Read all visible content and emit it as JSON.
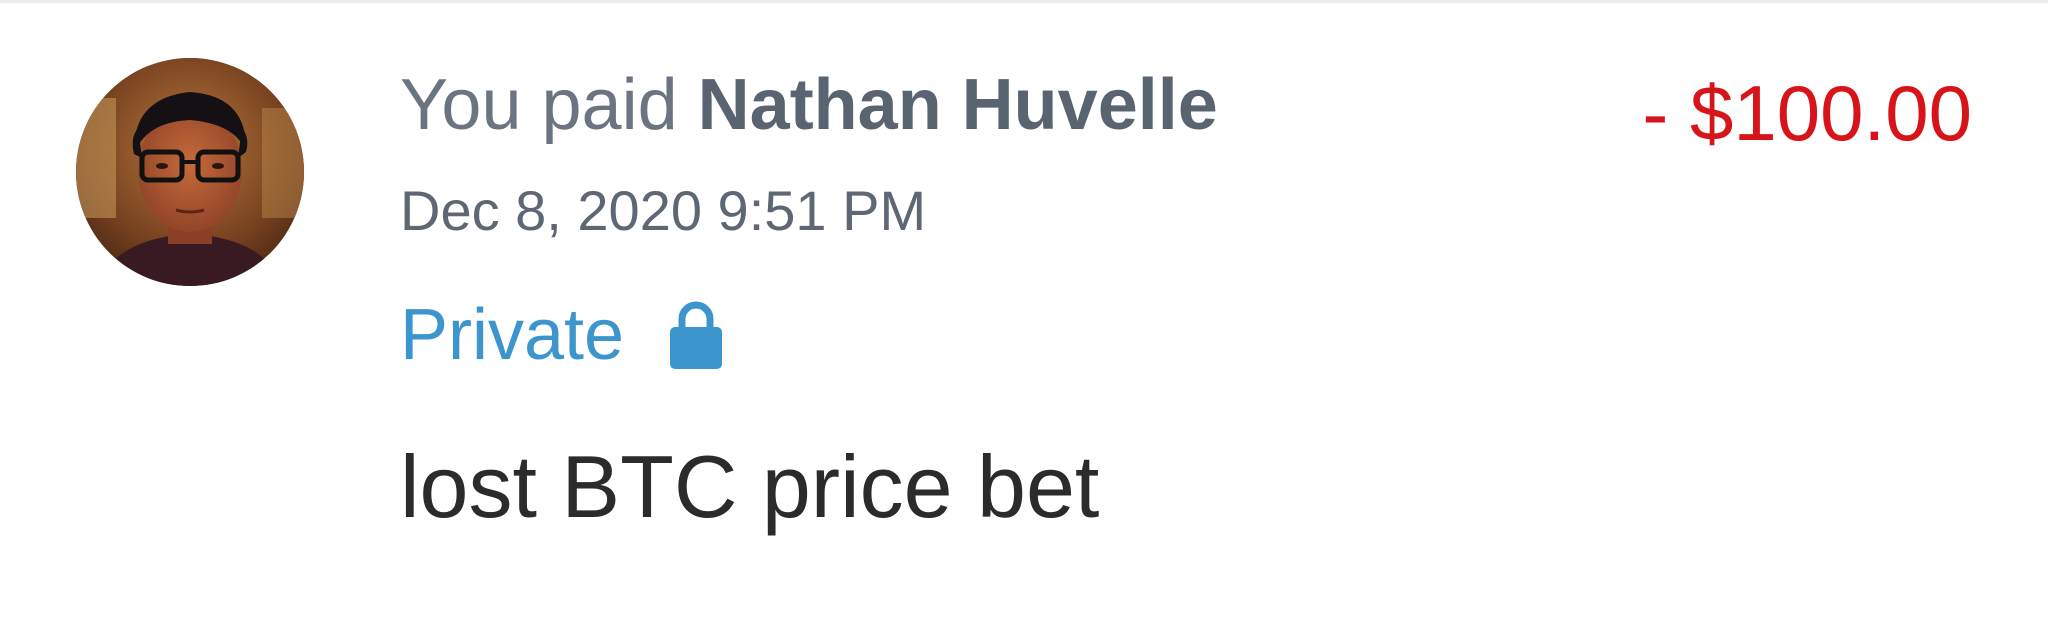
{
  "transaction": {
    "headline_prefix": "You paid",
    "recipient_name": "Nathan Huvelle",
    "amount": "- $100.00",
    "timestamp": "Dec 8, 2020 9:51 PM",
    "privacy_label": "Private",
    "privacy_icon": "lock-icon",
    "note": "lost BTC price bet"
  },
  "colors": {
    "amount_negative": "#d7141a",
    "privacy_blue": "#3d95ce",
    "secondary_text": "#6b7480",
    "primary_text": "#2b2b2b"
  }
}
